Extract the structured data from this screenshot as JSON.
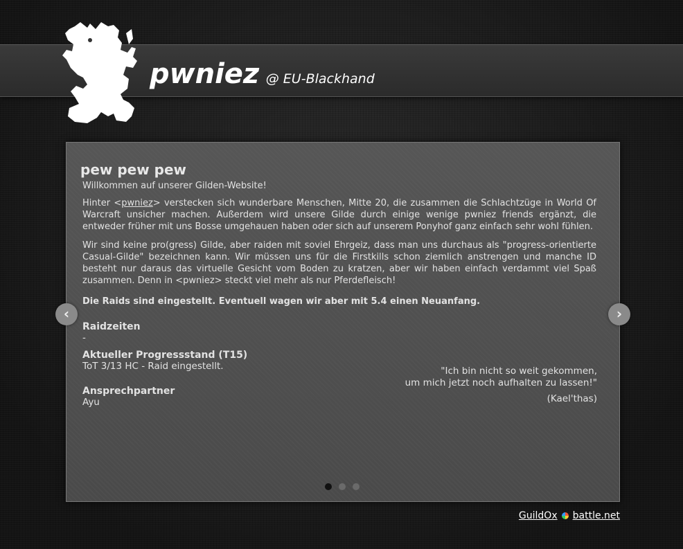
{
  "header": {
    "guild_name": "pwniez",
    "realm": "@ EU-Blackhand"
  },
  "slider": {
    "title": "pew pew pew",
    "welcome": "Willkommen auf unserer Gilden-Website!",
    "para1_before": "Hinter <",
    "para1_link": "pwniez",
    "para1_after": "> verstecken sich wunderbare Menschen, Mitte 20, die zusammen die Schlachtzüge in World Of Warcraft unsicher machen. Außerdem wird unsere Gilde durch einige wenige pwniez friends ergänzt, die entweder früher mit uns Bosse umgehauen haben oder sich auf unserem Ponyhof ganz einfach sehr wohl fühlen.",
    "para2": "Wir sind keine pro(gress) Gilde, aber raiden mit soviel Ehrgeiz, dass man uns durchaus als \"progress-orientierte Casual-Gilde\" bezeichnen kann. Wir müssen uns für die Firstkills schon ziemlich anstrengen und manche ID besteht nur daraus das virtuelle Gesicht vom Boden zu kratzen, aber wir haben einfach verdammt viel Spaß zusammen. Denn in <pwniez> steckt viel mehr als nur Pferdefleisch!",
    "notice": "Die Raids sind eingestellt. Eventuell wagen wir aber mit 5.4 einen Neuanfang.",
    "raidzeiten_label": "Raidzeiten",
    "raidzeiten_value": "-",
    "progress_label": "Aktueller Progressstand (T15)",
    "progress_value": "ToT 3/13 HC - Raid eingestellt.",
    "contact_label": "Ansprechpartner",
    "contact_value": "Ayu",
    "quote_line1": "\"Ich bin nicht so weit gekommen,",
    "quote_line2": "um mich jetzt noch aufhalten zu lassen!\"",
    "quote_author": "(Kael'thas)",
    "prev_icon": "chevron-left-icon",
    "next_icon": "chevron-right-icon",
    "slide_count": 3,
    "active_slide": 1
  },
  "footer": {
    "guildox": "GuildOx",
    "battlenet": "battle.net"
  }
}
